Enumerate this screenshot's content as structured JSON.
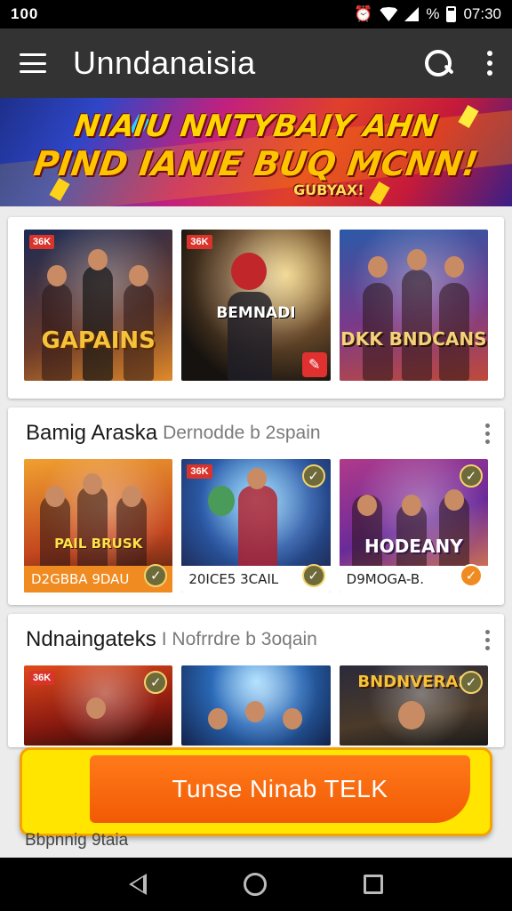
{
  "status_bar": {
    "left_text": "100",
    "battery_text": "%",
    "time": "07:30"
  },
  "app_bar": {
    "title": "Unndanaisia"
  },
  "banner": {
    "line1": "NIAIU NNTYBAIY AHN",
    "line2": "PIND IANIE BUQ MCNN!",
    "line3": "GUBYAX!"
  },
  "featured": {
    "tiles": [
      {
        "tag": "36K",
        "label": "GAPAINS"
      },
      {
        "tag": "36K",
        "label": "BEMNADI"
      },
      {
        "label": "DKK BNDCANS"
      }
    ]
  },
  "section1": {
    "title": "Bamig Araska",
    "subtitle": "Dernodde b 2spain",
    "tiles": [
      {
        "overlay": "PAIL BRUSK",
        "caption": "D2GBBA 9DAU"
      },
      {
        "tag": "36K",
        "caption": "20ICE5 3CAIL"
      },
      {
        "overlay": "HODEANY",
        "caption": "D9MOGA-B."
      }
    ]
  },
  "section2": {
    "title": "Ndnaingateks",
    "subtitle": "I Nofrrdre b 3oqain",
    "tiles": [
      {
        "tag": "36K"
      },
      {},
      {
        "overlay": "BNDNVERAS"
      }
    ]
  },
  "cta": {
    "label": "Tunse Ninab TELK"
  },
  "footer_cut_text": "Bbpnnig 9taia",
  "colors": {
    "app_bar": "#333333",
    "cta_yellow": "#ffe500",
    "cta_orange": "#f25a05",
    "accent_red": "#d9342b"
  }
}
